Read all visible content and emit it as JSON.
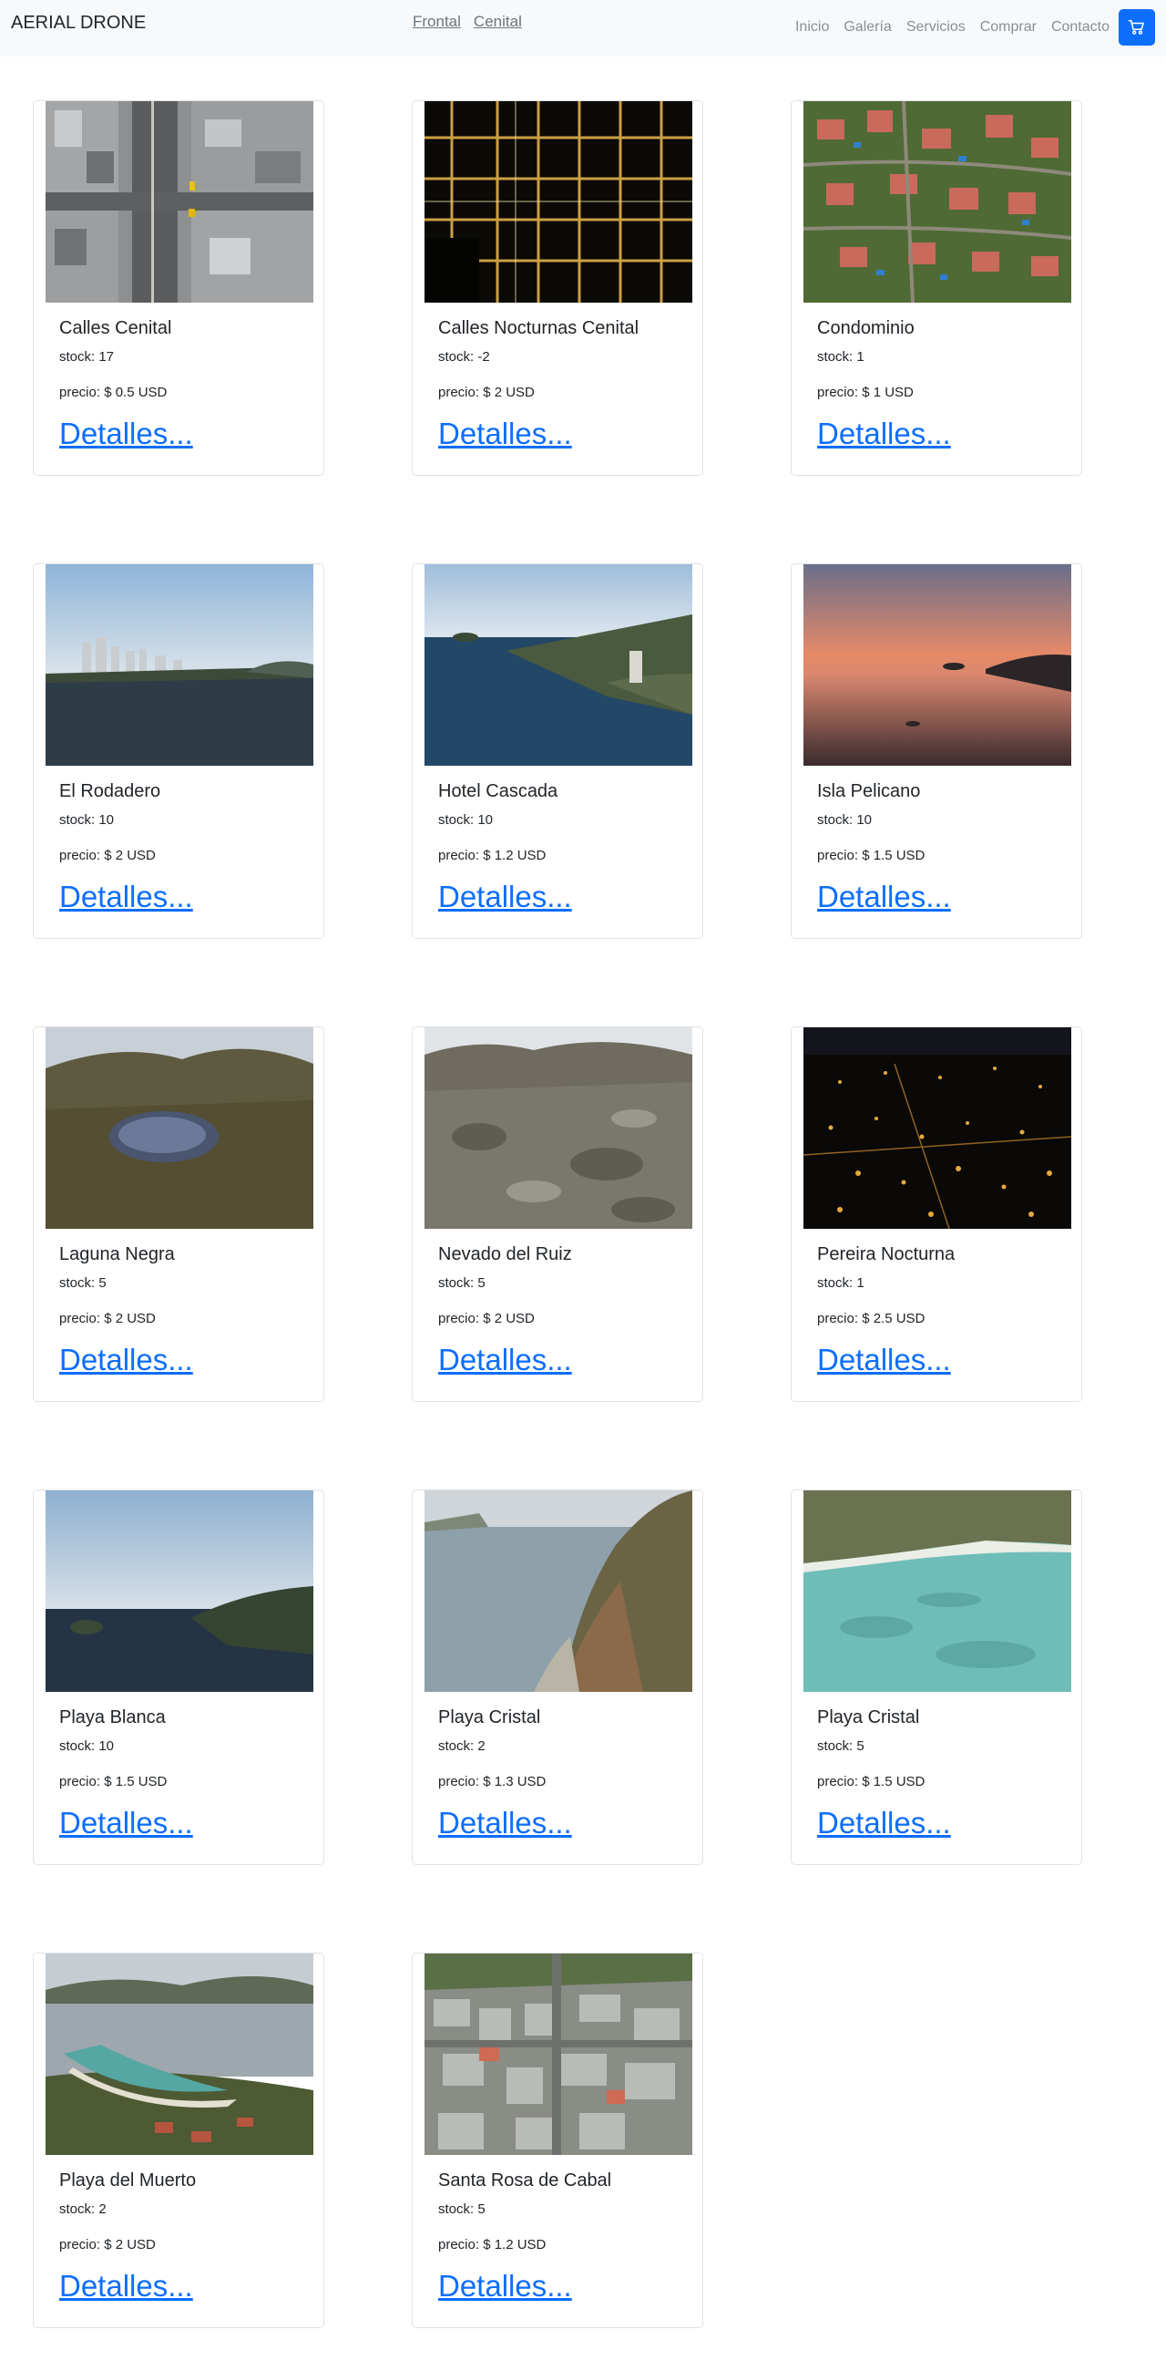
{
  "navbar": {
    "brand": "AERIAL DRONE",
    "subnav": [
      "Frontal",
      "Cenital"
    ],
    "menu": [
      "Inicio",
      "Galería",
      "Servicios",
      "Comprar",
      "Contacto"
    ],
    "cart_icon": "cart-icon"
  },
  "products": [
    {
      "title": "Calles Cenital",
      "stock": "stock: 17",
      "price": "precio: $ 0.5 USD",
      "link": "Detalles..."
    },
    {
      "title": "Calles Nocturnas Cenital",
      "stock": "stock: -2",
      "price": "precio: $ 2 USD",
      "link": "Detalles..."
    },
    {
      "title": "Condominio",
      "stock": "stock: 1",
      "price": "precio: $ 1 USD",
      "link": "Detalles..."
    },
    {
      "title": "El Rodadero",
      "stock": "stock: 10",
      "price": "precio: $ 2 USD",
      "link": "Detalles..."
    },
    {
      "title": "Hotel Cascada",
      "stock": "stock: 10",
      "price": "precio: $ 1.2 USD",
      "link": "Detalles..."
    },
    {
      "title": "Isla Pelicano",
      "stock": "stock: 10",
      "price": "precio: $ 1.5 USD",
      "link": "Detalles..."
    },
    {
      "title": "Laguna Negra",
      "stock": "stock: 5",
      "price": "precio: $ 2 USD",
      "link": "Detalles..."
    },
    {
      "title": "Nevado del Ruiz",
      "stock": "stock: 5",
      "price": "precio: $ 2 USD",
      "link": "Detalles..."
    },
    {
      "title": "Pereira Nocturna",
      "stock": "stock: 1",
      "price": "precio: $ 2.5 USD",
      "link": "Detalles..."
    },
    {
      "title": "Playa Blanca",
      "stock": "stock: 10",
      "price": "precio: $ 1.5 USD",
      "link": "Detalles..."
    },
    {
      "title": "Playa Cristal",
      "stock": "stock: 2",
      "price": "precio: $ 1.3 USD",
      "link": "Detalles..."
    },
    {
      "title": "Playa Cristal",
      "stock": "stock: 5",
      "price": "precio: $ 1.5 USD",
      "link": "Detalles..."
    },
    {
      "title": "Playa del Muerto",
      "stock": "stock: 2",
      "price": "precio: $ 2 USD",
      "link": "Detalles..."
    },
    {
      "title": "Santa Rosa de Cabal",
      "stock": "stock: 5",
      "price": "precio: $ 1.2 USD",
      "link": "Detalles..."
    }
  ],
  "colors": {
    "accent": "#0d6efd",
    "navbar_bg": "#f8f9fa",
    "card_border": "#dee2e6"
  }
}
